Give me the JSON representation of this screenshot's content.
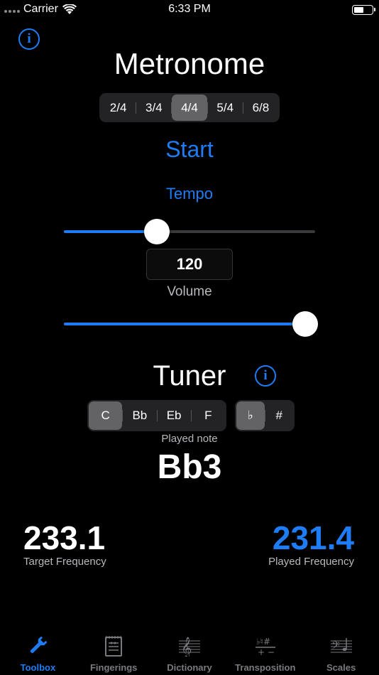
{
  "status_bar": {
    "carrier": "Carrier",
    "time": "6:33 PM",
    "battery_level": 0.55
  },
  "metronome": {
    "title": "Metronome",
    "time_signatures": [
      "2/4",
      "3/4",
      "4/4",
      "5/4",
      "6/8"
    ],
    "selected_time_signature": "4/4",
    "start_label": "Start",
    "tempo_label": "Tempo",
    "tempo_value": "120",
    "tempo_slider_fraction": 0.37,
    "volume_label": "Volume",
    "volume_slider_fraction": 0.96
  },
  "tuner": {
    "title": "Tuner",
    "transpositions": [
      "C",
      "Bb",
      "Eb",
      "F"
    ],
    "selected_transposition": "C",
    "accidentals": [
      "♭",
      "#"
    ],
    "selected_accidental": "♭",
    "played_note_label": "Played note",
    "played_note": "Bb3",
    "target_frequency": "233.1",
    "target_frequency_label": "Target Frequency",
    "played_frequency": "231.4",
    "played_frequency_label": "Played Frequency"
  },
  "tabs": [
    {
      "label": "Toolbox",
      "icon": "wrench-icon",
      "active": true
    },
    {
      "label": "Fingerings",
      "icon": "fingering-chart-icon",
      "active": false
    },
    {
      "label": "Dictionary",
      "icon": "treble-clef-icon",
      "active": false
    },
    {
      "label": "Transposition",
      "icon": "transposition-icon",
      "active": false
    },
    {
      "label": "Scales",
      "icon": "bass-clef-icon",
      "active": false
    }
  ],
  "colors": {
    "accent": "#1e7cf5",
    "background": "#000000",
    "inactive": "#7a7a7e"
  }
}
